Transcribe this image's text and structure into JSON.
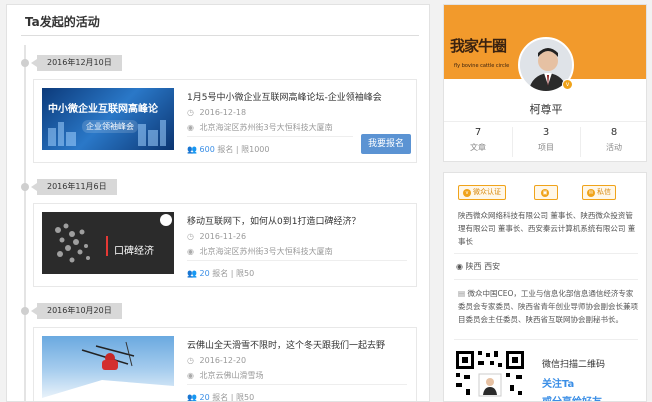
{
  "main": {
    "title": "Ta发起的活动",
    "events": [
      {
        "date": "2016年12月10日",
        "title": "1月5号中小微企业互联网高峰论坛-企业领袖峰会",
        "date_line": "2016-12-18",
        "location": "北京海淀区苏州街3号大恒科技大厦南",
        "registered": "600",
        "stat_suffix": "报名 | 限1000",
        "thumb_text_1": "中小微企业互联网高峰论",
        "thumb_text_2": "企业领袖峰会",
        "signup_label": "我要报名"
      },
      {
        "date": "2016年11月6日",
        "title": "移动互联网下，如何从0到1打造口碑经济？",
        "date_line": "2016-11-26",
        "location": "北京海淀区苏州街3号大恒科技大厦南",
        "registered": "20",
        "stat_suffix": "报名 | 限50",
        "thumb_text_1": "口碑经济"
      },
      {
        "date": "2016年10月20日",
        "title": "云佛山全天滑雪不限时，这个冬天跟我们一起去野",
        "date_line": "2016-12-20",
        "location": "北京云佛山滑雪场",
        "registered": "20",
        "stat_suffix": "报名 | 限50"
      }
    ]
  },
  "profile": {
    "banner_logo": "我家牛圈",
    "banner_sub": "fly bovine cattle circle",
    "name": "柯尊平",
    "stats": [
      {
        "value": "7",
        "label": "文章"
      },
      {
        "value": "3",
        "label": "项目"
      },
      {
        "value": "8",
        "label": "活动"
      }
    ]
  },
  "info": {
    "badges": [
      "微众认证",
      "",
      "私信"
    ],
    "company": "陕西微众网络科技有限公司 董事长、陕西微众投资管理有限公司 董事长、西安秦云计算机系统有限公司 董事长",
    "location": "陕西 西安",
    "bio": "微众中国CEO，工业与信息化部信息通信经济专家委员会专家委员、陕西省青年创业导师协会副会长兼项目委员会主任委员、陕西省互联网协会副秘书长。",
    "qr_title": "微信扫描二维码",
    "qr_follow": "关注Ta",
    "qr_share": "或分享给好友"
  },
  "colors": {
    "accent": "#5b93d3",
    "link": "#3a8ee6",
    "brand_orange": "#f29a2c",
    "badge_orange": "#f0a31a"
  }
}
